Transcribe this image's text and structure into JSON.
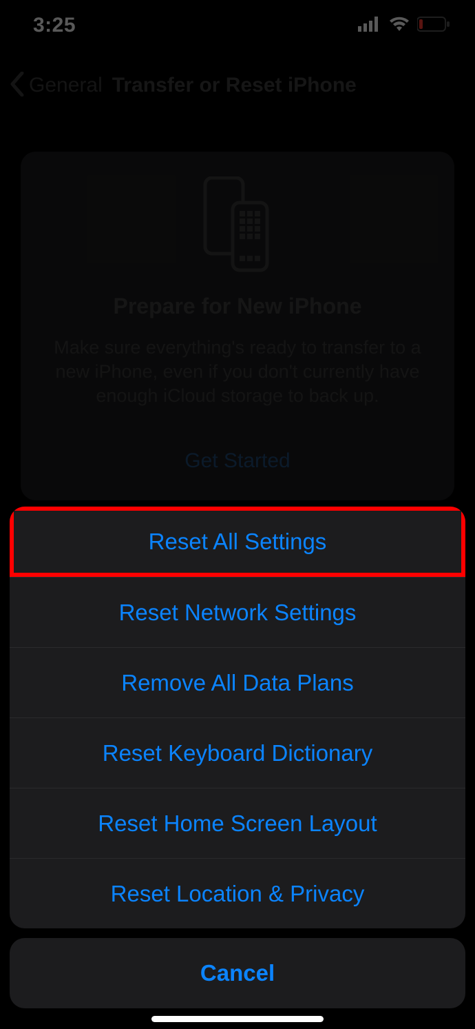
{
  "status": {
    "time": "3:25"
  },
  "nav": {
    "back_label": "General",
    "title": "Transfer or Reset iPhone"
  },
  "card": {
    "title": "Prepare for New iPhone",
    "description": "Make sure everything's ready to transfer to a new iPhone, even if you don't currently have enough iCloud storage to back up.",
    "link": "Get Started"
  },
  "sheet": {
    "items": [
      "Reset All Settings",
      "Reset Network Settings",
      "Remove All Data Plans",
      "Reset Keyboard Dictionary",
      "Reset Home Screen Layout",
      "Reset Location & Privacy"
    ],
    "cancel": "Cancel",
    "highlighted_index": 0
  }
}
